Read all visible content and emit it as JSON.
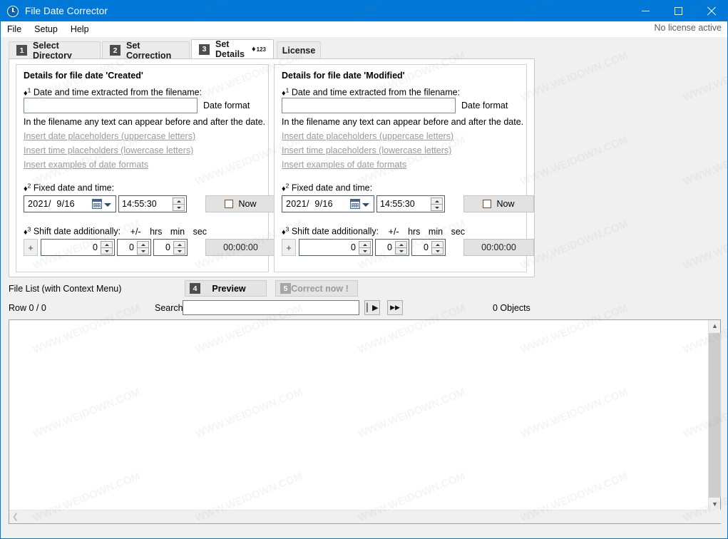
{
  "window": {
    "title": "File Date Corrector",
    "icon": "clock-icon",
    "minimize_label": "−",
    "maximize_label": "□",
    "close_label": "✕",
    "accent_color": "#0078d7"
  },
  "menubar": {
    "items": [
      {
        "label": "File"
      },
      {
        "label": "Setup"
      },
      {
        "label": "Help"
      }
    ],
    "license_status": "No license active"
  },
  "tabs": [
    {
      "num": "1",
      "label": "Select Directory",
      "active": false
    },
    {
      "num": "2",
      "label": "Set Correction",
      "active": false
    },
    {
      "num": "3",
      "label": "Set Details",
      "suffix": "♦",
      "sup": "123",
      "active": true
    },
    {
      "num": "",
      "label": "License",
      "active": false
    }
  ],
  "panels": [
    {
      "title": "Details for file date 'Created'",
      "step1": {
        "marker": "♦",
        "sup": "1",
        "label": "Date and time extracted from the filename:",
        "input_value": "",
        "input_placeholder": "",
        "side_label": "Date format",
        "hint": "In the filename any text can appear before and after the date.",
        "links": [
          "Insert date placeholders (uppercase letters)",
          "Insert time placeholders (lowercase letters)",
          "Insert examples of date formats"
        ]
      },
      "step2": {
        "marker": "♦",
        "sup": "2",
        "label": "Fixed date and time:",
        "date_value": "2021/  9/16",
        "time_value": "14:55:30",
        "now_label": "Now",
        "now_checked": false
      },
      "step3": {
        "marker": "♦",
        "sup": "3",
        "label": "Shift date additionally:",
        "units": [
          "+/-",
          "hrs",
          "min",
          "sec"
        ],
        "sign_label": "+",
        "hours": "0",
        "minutes": "0",
        "seconds": "0",
        "total": "00:00:00"
      }
    },
    {
      "title": "Details for file date 'Modified'",
      "step1": {
        "marker": "♦",
        "sup": "1",
        "label": "Date and time extracted from the filename:",
        "input_value": "",
        "input_placeholder": "",
        "side_label": "Date format",
        "hint": "In the filename any text can appear before and after the date.",
        "links": [
          "Insert date placeholders (uppercase letters)",
          "Insert time placeholders (lowercase letters)",
          "Insert examples of date formats"
        ]
      },
      "step2": {
        "marker": "♦",
        "sup": "2",
        "label": "Fixed date and time:",
        "date_value": "2021/  9/16",
        "time_value": "14:55:30",
        "now_label": "Now",
        "now_checked": false
      },
      "step3": {
        "marker": "♦",
        "sup": "3",
        "label": "Shift date additionally:",
        "units": [
          "+/-",
          "hrs",
          "min",
          "sec"
        ],
        "sign_label": "+",
        "hours": "0",
        "minutes": "0",
        "seconds": "0",
        "total": "00:00:00"
      }
    }
  ],
  "actions": {
    "filelist_label": "File List (with Context Menu)",
    "preview": {
      "num": "4",
      "label": "Preview",
      "disabled": false
    },
    "correct": {
      "num": "5",
      "label": "Correct now !",
      "disabled": true
    }
  },
  "statusrow": {
    "row_count": "Row 0 / 0",
    "search_label": "Search",
    "search_value": "",
    "search_placeholder": "",
    "find_first_icon": "▏▶",
    "find_next_icon": "▶▶",
    "object_count": "0 Objects"
  },
  "watermark": {
    "text": "WWW.WEIDOWN.COM"
  }
}
